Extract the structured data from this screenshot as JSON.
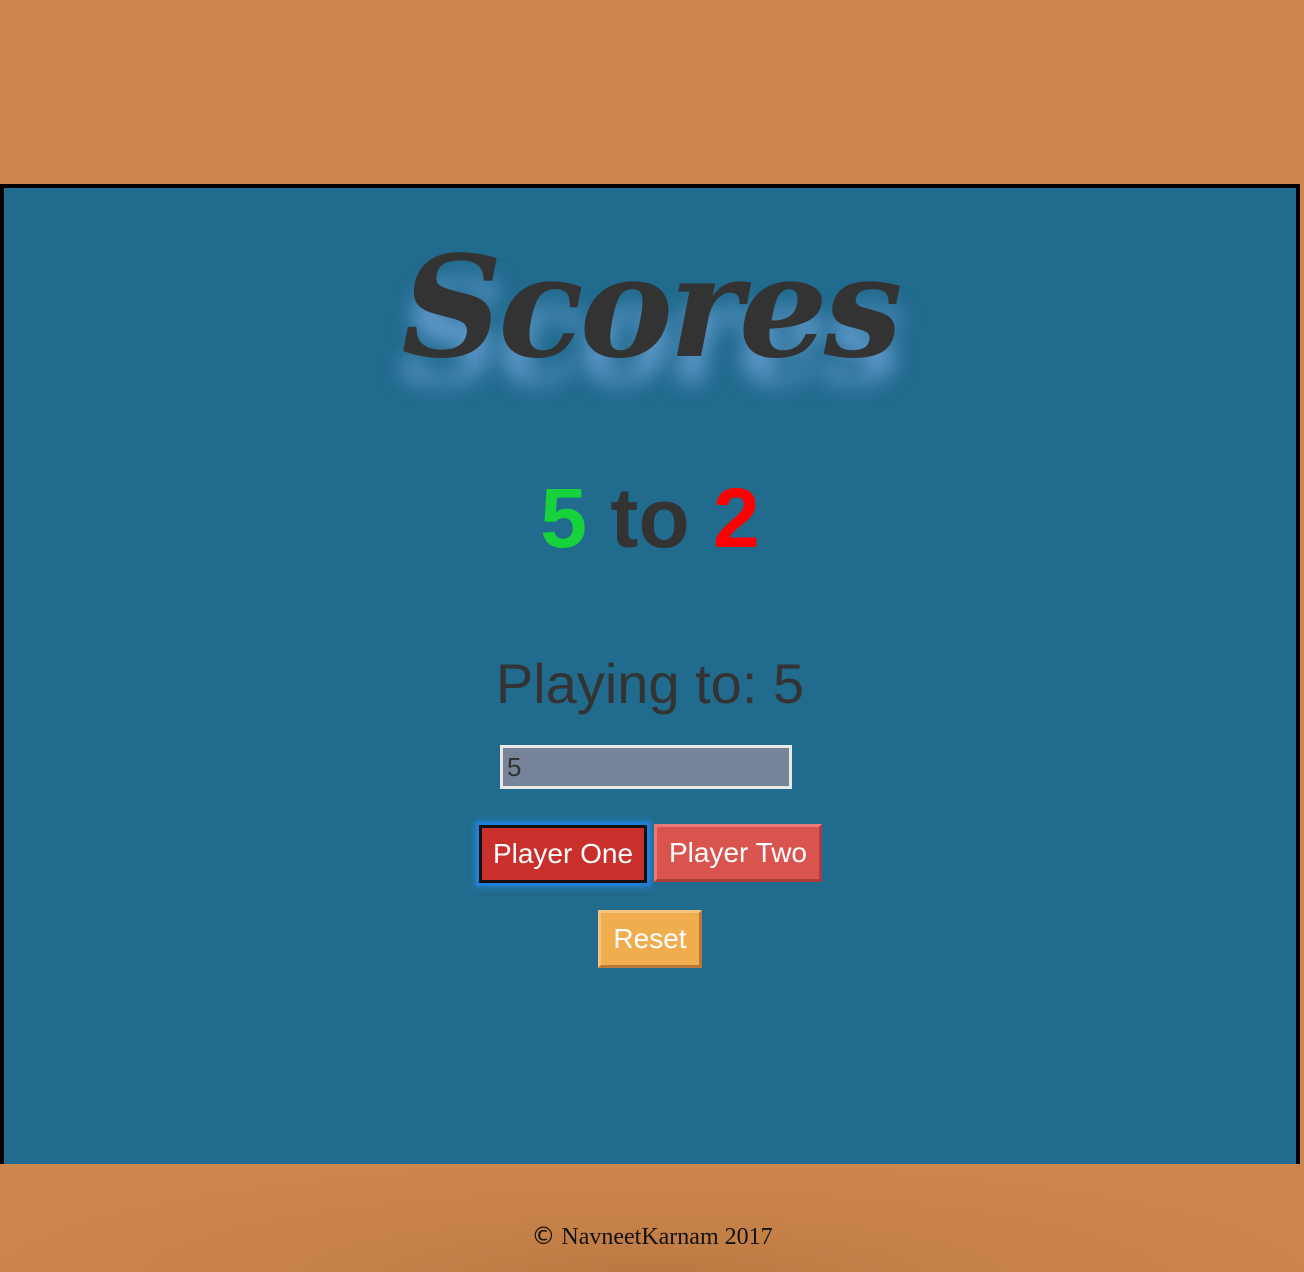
{
  "header": {
    "title": "Scores"
  },
  "score": {
    "player_one": "5",
    "separator": "to",
    "player_two": "2"
  },
  "playing_to": {
    "label": "Playing to:",
    "value": "5"
  },
  "limit_input": {
    "value": "5"
  },
  "buttons": {
    "player_one": "Player One",
    "player_two": "Player Two",
    "reset": "Reset"
  },
  "footer": {
    "copyright_icon": "©",
    "text": "NavneetKarnam 2017"
  },
  "colors": {
    "background": "#cd874c",
    "panel": "#216b8e",
    "player_one_score": "#17d23a",
    "player_two_score": "#ff0000",
    "player_one_button": "#c9302c",
    "player_two_button": "#d9534f",
    "reset_button": "#f0ad4e"
  }
}
